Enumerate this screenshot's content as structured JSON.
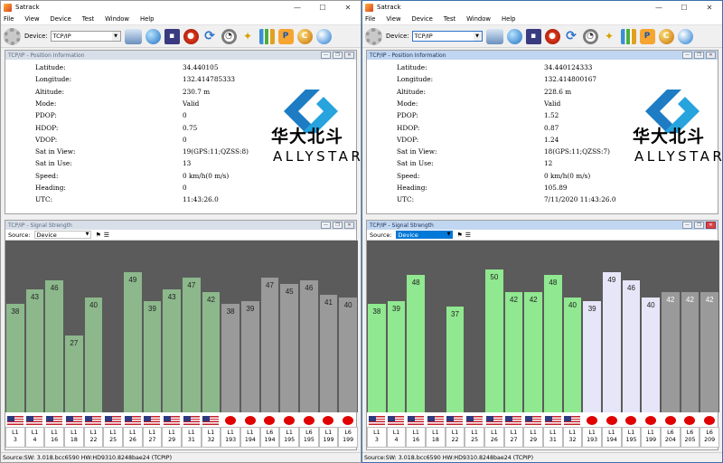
{
  "windows": [
    {
      "title": "Satrack",
      "menu": [
        "File",
        "View",
        "Device",
        "Test",
        "Window",
        "Help"
      ],
      "device_label": "Device:",
      "device_value": "TCP/IP",
      "position_panel_title": "TCP/IP - Position Information",
      "position": [
        {
          "label": "Latitude:",
          "value": "34.440105"
        },
        {
          "label": "Longitude:",
          "value": "132.414785333"
        },
        {
          "label": "Altitude:",
          "value": "230.7 m"
        },
        {
          "label": "Mode:",
          "value": "Valid"
        },
        {
          "label": "PDOP:",
          "value": "0"
        },
        {
          "label": "HDOP:",
          "value": "0.75"
        },
        {
          "label": "VDOP:",
          "value": "0"
        },
        {
          "label": "Sat in View:",
          "value": "19(GPS:11;QZSS:8)"
        },
        {
          "label": "Sat in Use:",
          "value": "13"
        },
        {
          "label": "Speed:",
          "value": "0 km/h(0 m/s)"
        },
        {
          "label": "Heading:",
          "value": "0"
        },
        {
          "label": "UTC:",
          "value": "11:43:26.0"
        }
      ],
      "logo_cn": "华大北斗",
      "logo_en": "ALLYSTAR",
      "signal_panel_title": "TCP/IP - Signal Strength",
      "source_label": "Source:",
      "source_value": "Device",
      "status_text": "Source:SW: 3.018.bcc6590  HW:HD9310.8248bae24  (TCPIP)"
    },
    {
      "title": "Satrack",
      "menu": [
        "File",
        "View",
        "Device",
        "Test",
        "Window",
        "Help"
      ],
      "device_label": "Device:",
      "device_value": "TCP/IP",
      "position_panel_title": "TCP/IP - Position Information",
      "position": [
        {
          "label": "Latitude:",
          "value": "34.440124333"
        },
        {
          "label": "Longitude:",
          "value": "132.414800167"
        },
        {
          "label": "Altitude:",
          "value": "228.6 m"
        },
        {
          "label": "Mode:",
          "value": "Valid"
        },
        {
          "label": "PDOP:",
          "value": "1.52"
        },
        {
          "label": "HDOP:",
          "value": "0.87"
        },
        {
          "label": "VDOP:",
          "value": "1.24"
        },
        {
          "label": "Sat in View:",
          "value": "18(GPS:11;QZSS:7)"
        },
        {
          "label": "Sat in Use:",
          "value": "12"
        },
        {
          "label": "Speed:",
          "value": "0 km/h(0 m/s)"
        },
        {
          "label": "Heading:",
          "value": "105.89"
        },
        {
          "label": "UTC:",
          "value": "7/11/2020 11:43:26.0"
        }
      ],
      "logo_cn": "华大北斗",
      "logo_en": "ALLYSTAR",
      "signal_panel_title": "TCP/IP - Signal Strength",
      "source_label": "Source:",
      "source_value": "Device",
      "status_text": "Source:SW: 3.018.bcc6590  HW:HD9310.8248bae24  (TCPIP)"
    }
  ],
  "chart_data": [
    {
      "type": "bar",
      "ylim": [
        0,
        60
      ],
      "categories": [
        "L1 3",
        "L1 4",
        "L1 16",
        "L1 18",
        "L1 22",
        "L1 25",
        "L1 26",
        "L1 27",
        "L1 29",
        "L1 31",
        "L1 32",
        "L1 193",
        "L1 194",
        "L6 194",
        "L1 195",
        "L6 195",
        "L1 199",
        "L6 199"
      ],
      "values": [
        38,
        43,
        46,
        27,
        40,
        null,
        49,
        39,
        43,
        47,
        42,
        38,
        39,
        47,
        45,
        46,
        41,
        40,
        42
      ],
      "systems": [
        "gps",
        "gps",
        "gps",
        "gps",
        "gps",
        "gps",
        "gps",
        "gps",
        "gps",
        "gps",
        "gps",
        "qzss",
        "qzss",
        "qzss",
        "qzss",
        "qzss",
        "qzss",
        "qzss"
      ],
      "in_use": [
        true,
        true,
        true,
        false,
        true,
        false,
        true,
        true,
        true,
        true,
        true,
        false,
        false,
        false,
        false,
        false,
        false,
        false
      ]
    },
    {
      "type": "bar",
      "ylim": [
        0,
        60
      ],
      "categories": [
        "L1 3",
        "L1 4",
        "L1 16",
        "L1 18",
        "L1 22",
        "L1 25",
        "L1 26",
        "L1 27",
        "L1 29",
        "L1 31",
        "L1 32",
        "L1 193",
        "L1 194",
        "L1 195",
        "L1 199",
        "L6 204",
        "L6 205",
        "L6 209"
      ],
      "values": [
        38,
        39,
        48,
        null,
        37,
        null,
        50,
        42,
        42,
        48,
        40,
        39,
        49,
        46,
        40,
        42,
        42,
        42
      ],
      "systems": [
        "gps",
        "gps",
        "gps",
        "gps",
        "gps",
        "gps",
        "gps",
        "gps",
        "gps",
        "gps",
        "gps",
        "qzss",
        "qzss",
        "qzss",
        "qzss",
        "qzss",
        "qzss",
        "qzss"
      ],
      "in_use": [
        true,
        true,
        true,
        false,
        true,
        false,
        true,
        true,
        true,
        true,
        true,
        true,
        true,
        true,
        true,
        false,
        false,
        false
      ]
    }
  ],
  "colors": {
    "gps_used": "#90e890",
    "gps_used_dim": "#8cb88c",
    "qzss_used": "#e6e6f8",
    "qzss_dim": "#9a9a9a",
    "unused": "#6d6d6d",
    "chart_bg": "#5b5b5b"
  }
}
